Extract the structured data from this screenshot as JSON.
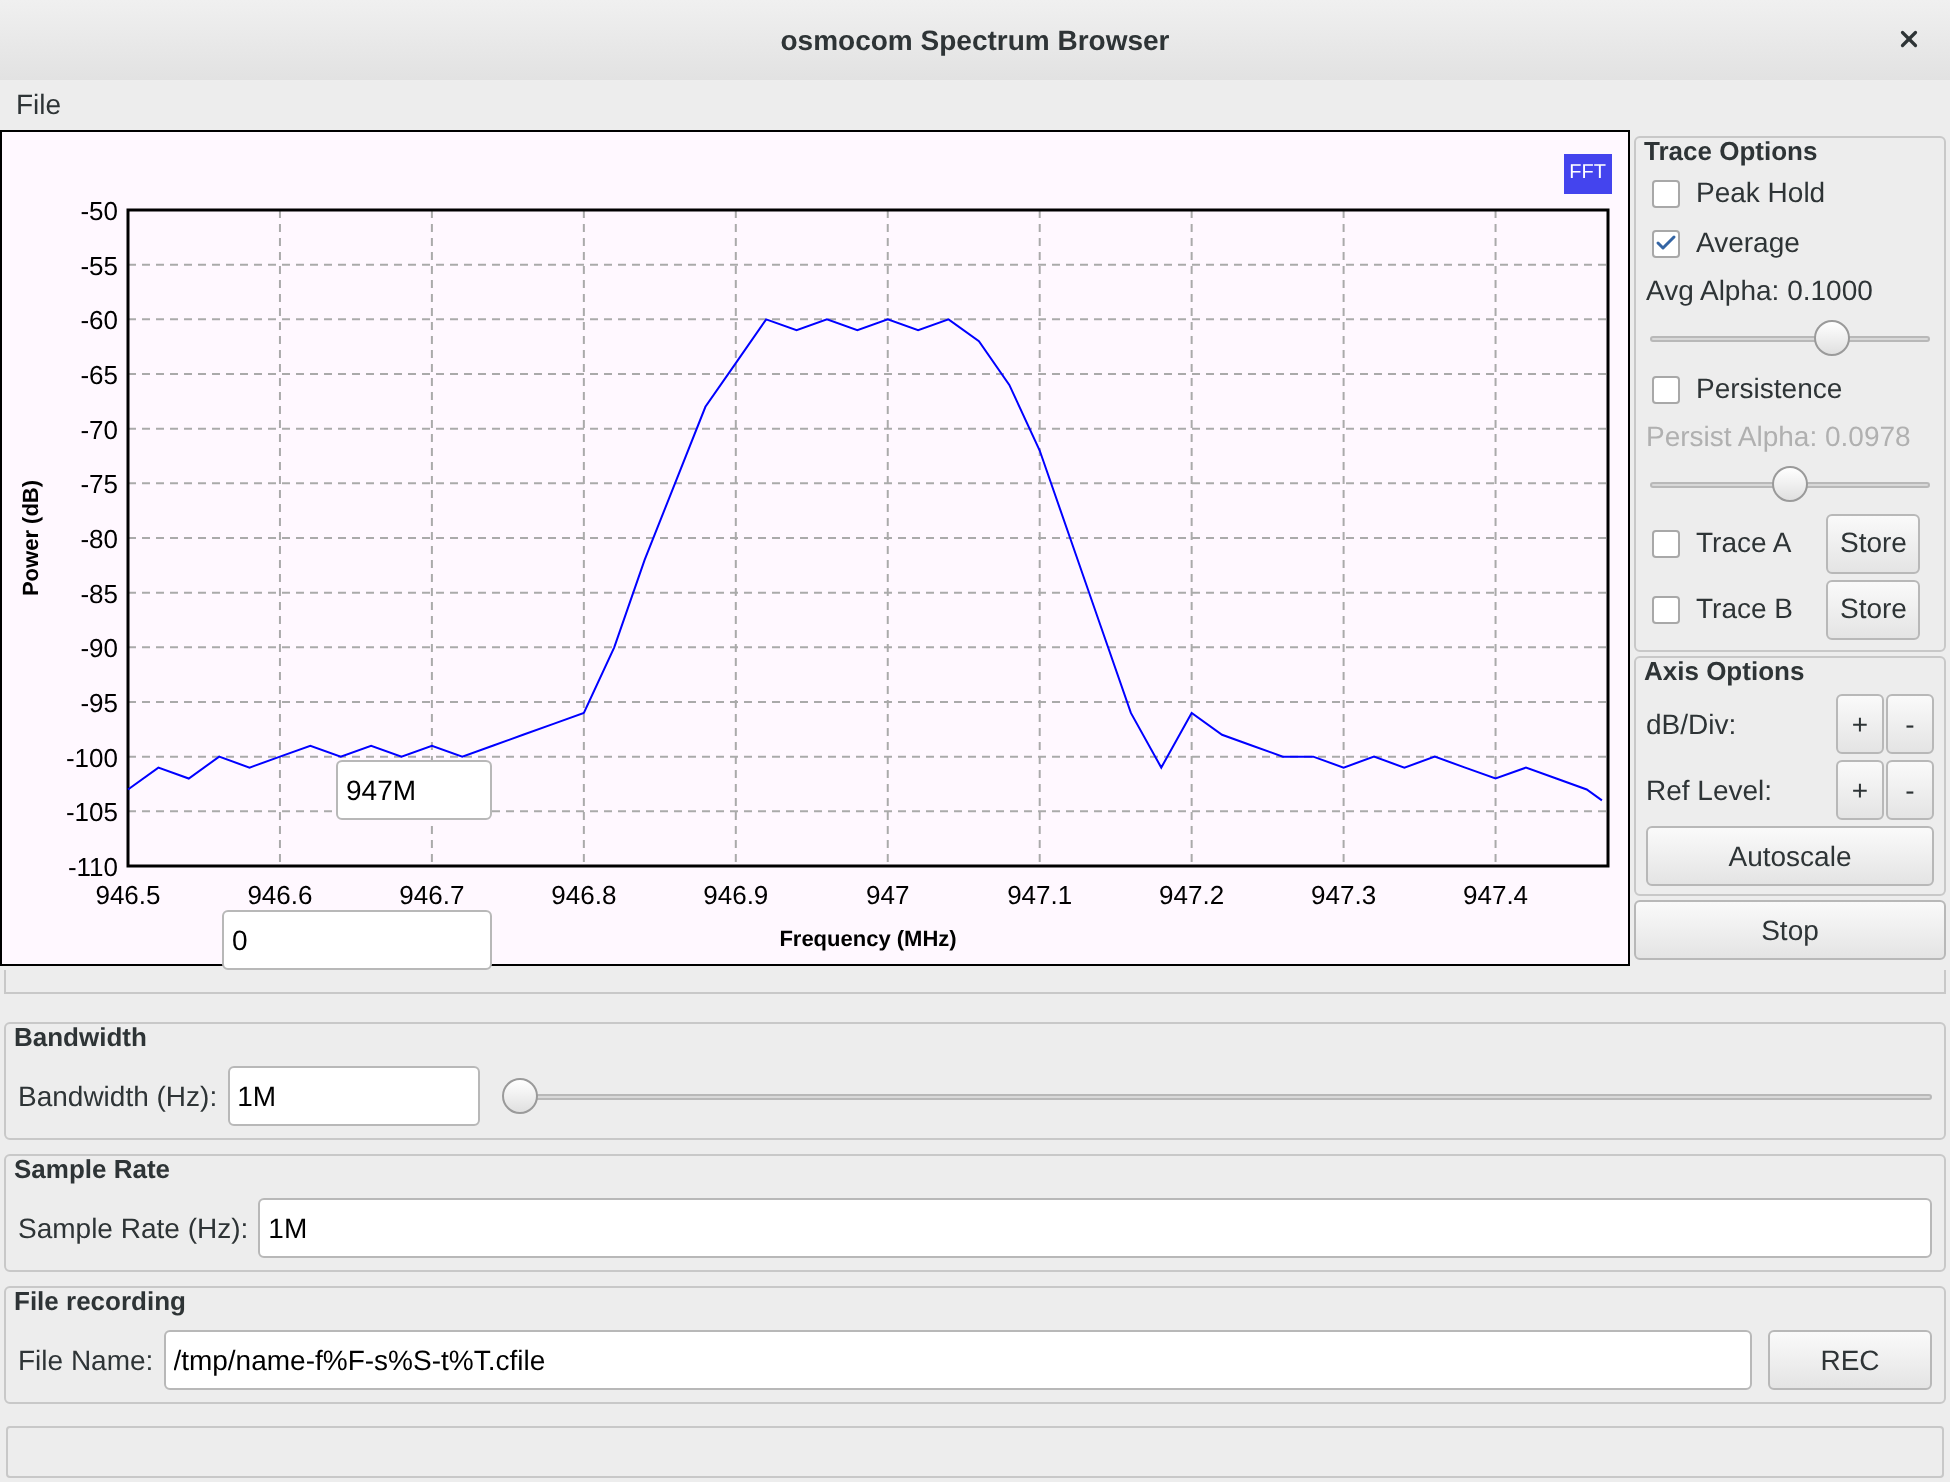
{
  "window": {
    "title": "osmocom Spectrum Browser"
  },
  "menu": [
    {
      "label": "File"
    }
  ],
  "plot": {
    "center_field": {
      "value": "947M"
    },
    "span_field": {
      "value": "0"
    },
    "chart_data": {
      "type": "line",
      "grid": true,
      "xlabel": "Frequency (MHz)",
      "ylabel": "Power (dB)",
      "xlim": [
        946.5,
        947.474
      ],
      "ylim": [
        -110,
        -50
      ],
      "xticks": [
        946.5,
        946.6,
        946.7,
        946.8,
        946.9,
        947,
        947.1,
        947.2,
        947.3,
        947.4
      ],
      "yticks": [
        -50,
        -55,
        -60,
        -65,
        -70,
        -75,
        -80,
        -85,
        -90,
        -95,
        -100,
        -105,
        -110
      ],
      "x": [
        946.5,
        946.52,
        946.54,
        946.56,
        946.58,
        946.6,
        946.62,
        946.64,
        946.66,
        946.68,
        946.7,
        946.72,
        946.74,
        946.76,
        946.78,
        946.8,
        946.82,
        946.84,
        946.86,
        946.88,
        946.9,
        946.92,
        946.94,
        946.96,
        946.98,
        947,
        947.02,
        947.04,
        947.06,
        947.08,
        947.1,
        947.12,
        947.14,
        947.16,
        947.18,
        947.2,
        947.22,
        947.24,
        947.26,
        947.28,
        947.3,
        947.32,
        947.34,
        947.36,
        947.38,
        947.4,
        947.42,
        947.44,
        947.46,
        947.47
      ],
      "series": [
        {
          "name": "FFT",
          "color": "#0000ff",
          "values": [
            -103,
            -101,
            -102,
            -100,
            -101,
            -100,
            -99,
            -100,
            -99,
            -100,
            -99,
            -100,
            -99,
            -98,
            -97,
            -96,
            -90,
            -82,
            -75,
            -68,
            -64,
            -60,
            -61,
            -60,
            -61,
            -60,
            -61,
            -60,
            -62,
            -66,
            -72,
            -80,
            -88,
            -96,
            -101,
            -96,
            -98,
            -99,
            -100,
            -100,
            -101,
            -100,
            -101,
            -100,
            -101,
            -102,
            -101,
            -102,
            -103,
            -104
          ]
        }
      ]
    }
  },
  "trace_options": {
    "title": "Trace Options",
    "items": [
      {
        "kind": "checkbox",
        "label": "Peak Hold",
        "checked": false
      },
      {
        "kind": "checkbox",
        "label": "Average",
        "checked": true
      },
      {
        "kind": "label",
        "label": "Avg Alpha: 0.1000",
        "disabled": false
      },
      {
        "kind": "slider",
        "level": 0.65
      },
      {
        "kind": "checkbox",
        "label": "Persistence",
        "checked": false
      },
      {
        "kind": "label",
        "label": "Persist Alpha: 0.0978",
        "disabled": true
      },
      {
        "kind": "slider",
        "level": 0.5
      },
      {
        "kind": "store",
        "label": "Trace A",
        "checked": false,
        "button": "Store"
      },
      {
        "kind": "store",
        "label": "Trace B",
        "checked": false,
        "button": "Store"
      }
    ]
  },
  "axis_options": {
    "title": "Axis Options",
    "rows": [
      {
        "label": "dB/Div:",
        "plus": "+",
        "minus": "-"
      },
      {
        "label": "Ref Level:",
        "plus": "+",
        "minus": "-"
      }
    ],
    "autoscale": "Autoscale"
  },
  "stop": "Stop",
  "bandwidth": {
    "title": "Bandwidth",
    "label": "Bandwidth (Hz):",
    "value": "1M",
    "level": 0.01
  },
  "sample_rate": {
    "title": "Sample Rate",
    "label": "Sample Rate (Hz):",
    "value": "1M"
  },
  "file_recording": {
    "title": "File recording",
    "label": "File Name:",
    "value": "/tmp/name-f%F-s%S-t%T.cfile",
    "button": "REC"
  }
}
